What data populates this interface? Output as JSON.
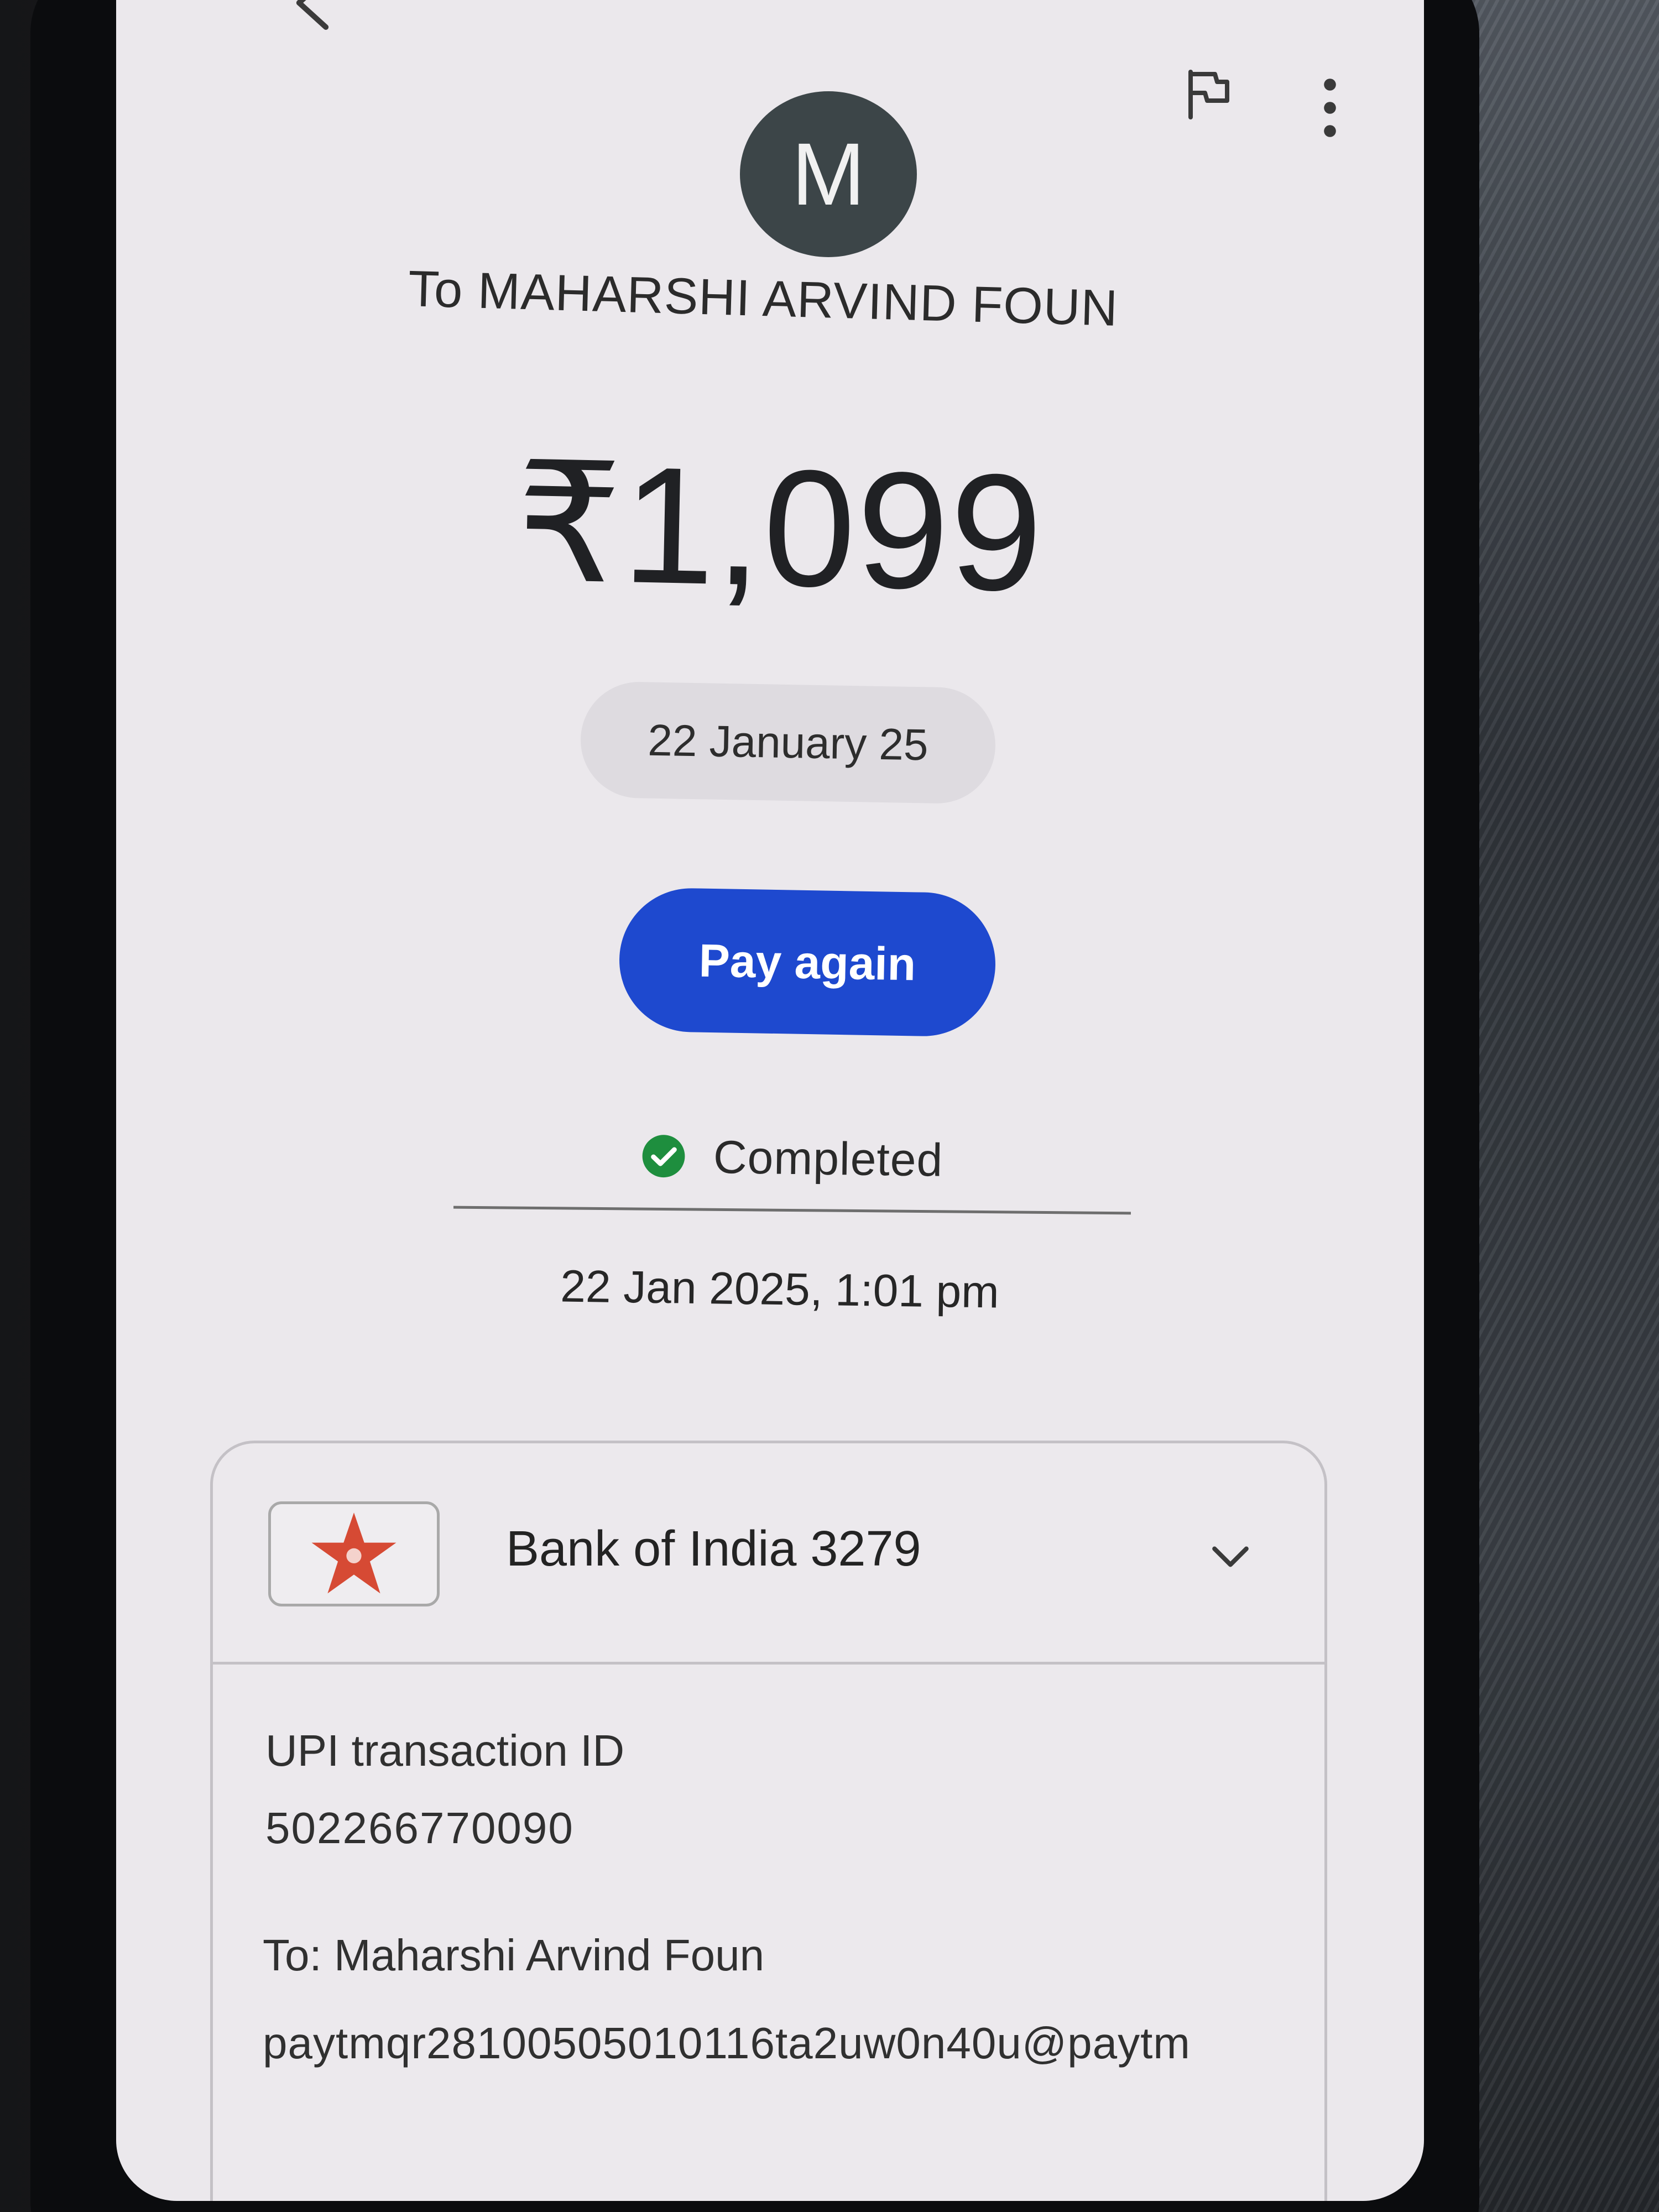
{
  "header": {
    "back_icon": "chevron-left-icon",
    "flag_icon": "flag-icon",
    "more_icon": "vertical-dots-icon"
  },
  "recipient": {
    "avatar_initial": "M",
    "title": "To MAHARSHI ARVIND FOUN"
  },
  "payment": {
    "amount": "₹1,099",
    "date_chip": "22 January 25",
    "pay_again_label": "Pay again",
    "status": "Completed",
    "status_color": "#1e8e3e",
    "timestamp": "22 Jan 2025, 1:01 pm"
  },
  "details": {
    "bank_name": "Bank of India 3279",
    "bank_logo_color": "#d64a34",
    "upi_label": "UPI transaction ID",
    "upi_value": "502266770090",
    "to_label": "To: Maharshi Arvind Foun",
    "to_value": "paytmqr28100505010116ta2uw0n40u@paytm"
  },
  "colors": {
    "primary_button": "#1e49cf",
    "avatar_bg": "#3c4548",
    "screen_bg": "#ebe8ec"
  }
}
